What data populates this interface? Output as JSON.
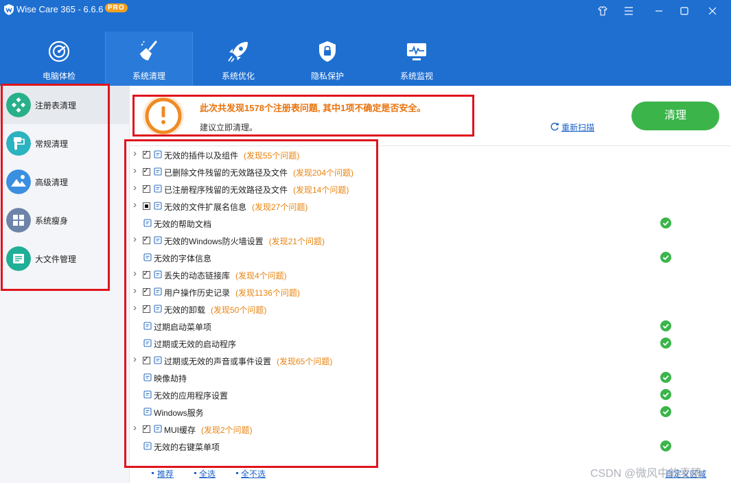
{
  "app": {
    "title": "Wise Care 365 - 6.6.6",
    "badge": "PRO"
  },
  "window_controls": [
    "skin-icon",
    "menu-icon",
    "minimize-icon",
    "maximize-icon",
    "close-icon"
  ],
  "nav": {
    "tabs": [
      {
        "label": "电脑体检",
        "icon": "radar-icon"
      },
      {
        "label": "系统清理",
        "icon": "broom-icon",
        "active": true
      },
      {
        "label": "系统优化",
        "icon": "rocket-icon"
      },
      {
        "label": "隐私保护",
        "icon": "lock-shield-icon"
      },
      {
        "label": "系统监视",
        "icon": "monitor-icon"
      }
    ]
  },
  "sidebar": {
    "items": [
      {
        "label": "注册表清理",
        "icon": "registry-icon",
        "active": true
      },
      {
        "label": "常规清理",
        "icon": "brush-icon"
      },
      {
        "label": "高级清理",
        "icon": "cloud-mountain-icon"
      },
      {
        "label": "系统瘦身",
        "icon": "windows-icon"
      },
      {
        "label": "大文件管理",
        "icon": "folder-list-icon"
      }
    ]
  },
  "header": {
    "title": "此次共发现1578个注册表问题, 其中1项不确定是否安全。",
    "subtitle": "建议立即清理。",
    "rescan": "重新扫描",
    "clean_button": "清理"
  },
  "rows": [
    {
      "name": "无效的插件以及组件",
      "count": "(发现55个问题)",
      "expandable": true,
      "check": "checked",
      "icon": "plugin-icon"
    },
    {
      "name": "已删除文件残留的无效路径及文件",
      "count": "(发现204个问题)",
      "expandable": true,
      "check": "checked",
      "icon": "folder-icon"
    },
    {
      "name": "已注册程序残留的无效路径及文件",
      "count": "(发现14个问题)",
      "expandable": true,
      "check": "checked",
      "icon": "file-icon"
    },
    {
      "name": "无效的文件扩展名信息",
      "count": "(发现27个问题)",
      "expandable": true,
      "check": "partial",
      "icon": "file-ext-icon"
    },
    {
      "name": "无效的帮助文档",
      "count": "",
      "expandable": false,
      "check": "none",
      "icon": "help-doc-icon",
      "ok": true
    },
    {
      "name": "无效的Windows防火墙设置",
      "count": "(发现21个问题)",
      "expandable": true,
      "check": "checked",
      "icon": "firewall-shield-icon"
    },
    {
      "name": "无效的字体信息",
      "count": "",
      "expandable": false,
      "check": "none",
      "icon": "font-icon",
      "ok": true
    },
    {
      "name": "丢失的动态链接库",
      "count": "(发现4个问题)",
      "expandable": true,
      "check": "checked",
      "icon": "link-icon"
    },
    {
      "name": "用户操作历史记录",
      "count": "(发现1136个问题)",
      "expandable": true,
      "check": "checked",
      "icon": "history-icon"
    },
    {
      "name": "无效的卸载",
      "count": "(发现50个问题)",
      "expandable": true,
      "check": "checked",
      "icon": "uninstall-icon"
    },
    {
      "name": "过期启动菜单项",
      "count": "",
      "expandable": false,
      "check": "none",
      "icon": "start-menu-icon",
      "ok": true
    },
    {
      "name": "过期或无效的启动程序",
      "count": "",
      "expandable": false,
      "check": "none",
      "icon": "startup-program-icon",
      "ok": true
    },
    {
      "name": "过期或无效的声音或事件设置",
      "count": "(发现65个问题)",
      "expandable": true,
      "check": "checked",
      "icon": "sound-icon"
    },
    {
      "name": "映像劫持",
      "count": "",
      "expandable": false,
      "check": "none",
      "icon": "bug-icon",
      "ok": true
    },
    {
      "name": "无效的应用程序设置",
      "count": "",
      "expandable": false,
      "check": "none",
      "icon": "warning-icon",
      "ok": true
    },
    {
      "name": "Windows服务",
      "count": "",
      "expandable": false,
      "check": "none",
      "icon": "windows-service-icon",
      "ok": true
    },
    {
      "name": "MUI缓存",
      "count": "(发现2个问题)",
      "expandable": true,
      "check": "checked",
      "icon": "mui-cache-icon"
    },
    {
      "name": "无效的右键菜单项",
      "count": "",
      "expandable": false,
      "check": "none",
      "icon": "mouse-icon",
      "ok": true
    }
  ],
  "footer": {
    "recommend": "推荐",
    "select_all": "全选",
    "select_none": "全不选",
    "custom_area": "自定义区域"
  },
  "watermark": "CSDN @微风中的麦穗",
  "colors": {
    "nav_bg": "#1f6fd1",
    "accent_orange": "#e8730c",
    "clean_green": "#3bb54a",
    "link_blue": "#1c62c8",
    "highlight_red": "#e0131b"
  }
}
